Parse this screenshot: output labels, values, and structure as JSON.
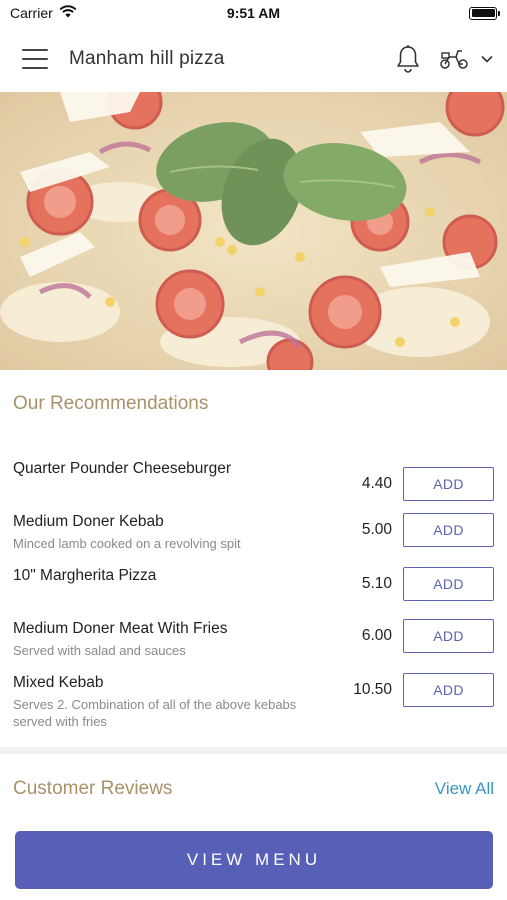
{
  "status_bar": {
    "carrier": "Carrier",
    "time": "9:51 AM"
  },
  "header": {
    "title": "Manham hill pizza"
  },
  "hero": {
    "image_subject": "pizza-photo"
  },
  "recommendations": {
    "title": "Our Recommendations",
    "items": [
      {
        "name": "Quarter Pounder Cheeseburger",
        "description": "",
        "price": "4.40",
        "add_label": "ADD"
      },
      {
        "name": "Medium Doner Kebab",
        "description": "Minced lamb cooked on a revolving spit",
        "price": "5.00",
        "add_label": "ADD"
      },
      {
        "name": "10\" Margherita Pizza",
        "description": "",
        "price": "5.10",
        "add_label": "ADD"
      },
      {
        "name": "Medium Doner Meat With Fries",
        "description": "Served with salad and sauces",
        "price": "6.00",
        "add_label": "ADD"
      },
      {
        "name": "Mixed Kebab",
        "description": "Serves 2. Combination of all of the above kebabs served with fries",
        "price": "10.50",
        "add_label": "ADD"
      }
    ]
  },
  "reviews": {
    "title": "Customer Reviews",
    "view_all_label": "View All"
  },
  "footer": {
    "view_menu_label": "VIEW MENU"
  },
  "colors": {
    "accent": "#5760b6",
    "section_title": "#a7926a",
    "link": "#3a96c4"
  }
}
